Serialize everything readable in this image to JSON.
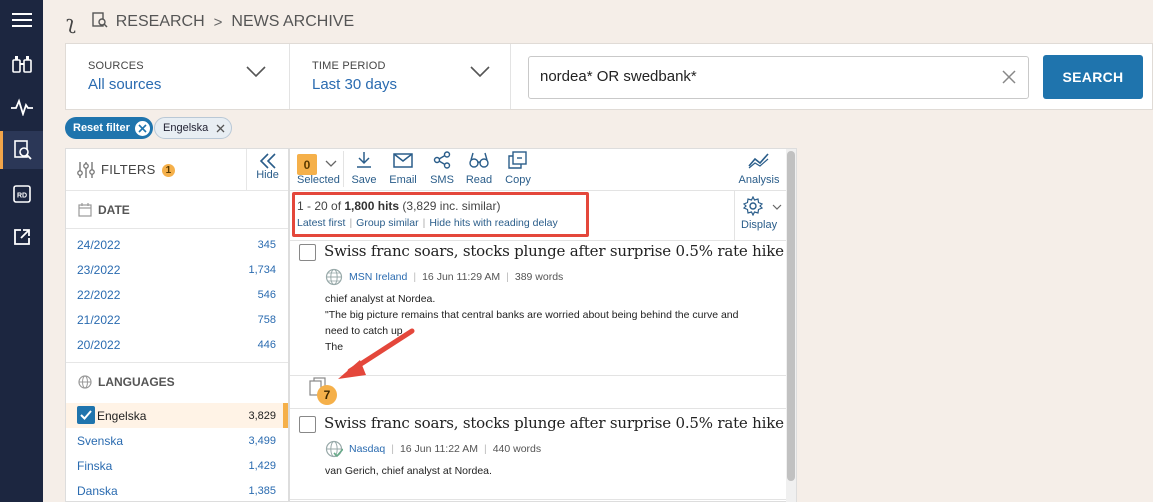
{
  "breadcrumb": {
    "section": "RESEARCH",
    "page": "NEWS ARCHIVE"
  },
  "filters_bar": {
    "sources": {
      "label": "SOURCES",
      "value": "All sources"
    },
    "time_period": {
      "label": "TIME PERIOD",
      "value": "Last 30 days"
    },
    "search": {
      "value": "nordea* OR swedbank*"
    },
    "search_button": "SEARCH"
  },
  "chips": {
    "reset": "Reset filter",
    "language": "Engelska"
  },
  "filter_panel": {
    "title": "FILTERS",
    "badge": "1",
    "hide_label": "Hide",
    "date_section": "DATE",
    "dates": [
      {
        "label": "24/2022",
        "count": "345"
      },
      {
        "label": "23/2022",
        "count": "1,734"
      },
      {
        "label": "22/2022",
        "count": "546"
      },
      {
        "label": "21/2022",
        "count": "758"
      },
      {
        "label": "20/2022",
        "count": "446"
      }
    ],
    "languages_section": "LANGUAGES",
    "languages": [
      {
        "label": "Engelska",
        "count": "3,829",
        "selected": true
      },
      {
        "label": "Svenska",
        "count": "3,499"
      },
      {
        "label": "Finska",
        "count": "1,429"
      },
      {
        "label": "Danska",
        "count": "1,385"
      }
    ]
  },
  "toolbar": {
    "selected_count": "0",
    "selected": "Selected",
    "save": "Save",
    "email": "Email",
    "sms": "SMS",
    "read": "Read",
    "copy": "Copy",
    "analysis": "Analysis",
    "display": "Display"
  },
  "results": {
    "range": "1 - 20 of",
    "hits": "1,800 hits",
    "similar": "(3,829 inc. similar)",
    "sort": "Latest first",
    "group": "Group similar",
    "hide_delay": "Hide hits with reading delay"
  },
  "articles": [
    {
      "title": "Swiss franc soars, stocks plunge after surprise 0.5% rate hike",
      "source": "MSN Ireland",
      "date": "16 Jun 11:29 AM",
      "words": "389 words",
      "snippet_lines": [
        "chief analyst at Nordea.",
        "\"The big picture remains that central banks are worried about being behind the curve and",
        "need to catch up",
        "The"
      ],
      "similar_count": "7"
    },
    {
      "title": "Swiss franc soars, stocks plunge after surprise 0.5% rate hike",
      "source": "Nasdaq",
      "date": "16 Jun 11:22 AM",
      "words": "440 words",
      "snippet_lines": [
        "van Gerich, chief analyst at Nordea."
      ]
    }
  ],
  "colors": {
    "accent": "#1f74ad",
    "badge": "#f5b04a",
    "highlight_box": "#e4473b",
    "rail": "#1c2640"
  }
}
